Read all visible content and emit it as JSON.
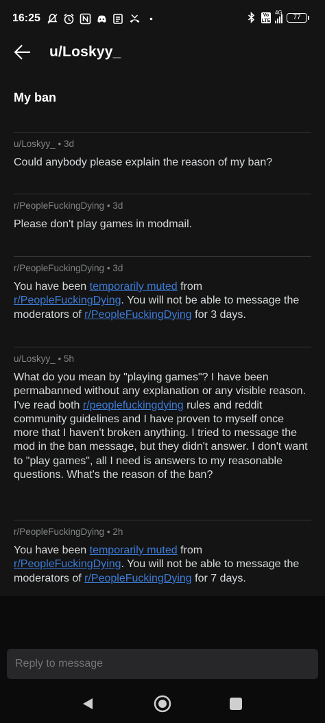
{
  "status_bar": {
    "time": "16:25",
    "network_label": "4G",
    "volte_label": "Vo LTE",
    "battery_level": "77",
    "icons": [
      "muted-notifications-icon",
      "alarm-icon",
      "nfc-icon",
      "discord-icon",
      "news-icon",
      "missed-call-icon",
      "dot-icon",
      "bluetooth-icon",
      "volte-icon",
      "signal-icon",
      "battery-icon"
    ]
  },
  "header": {
    "title": "u/Loskyy_",
    "subject": "My ban"
  },
  "messages": [
    {
      "author": "u/Loskyy_",
      "time": "3d",
      "body_parts": [
        "Could anybody please explain the reason of my ban?"
      ]
    },
    {
      "author": "r/PeopleFuckingDying",
      "time": "3d",
      "body_parts": [
        "Please don't play games in modmail."
      ]
    },
    {
      "author": "r/PeopleFuckingDying",
      "time": "3d",
      "body_parts": [
        "You have been ",
        "temporarily muted",
        " from ",
        "r/PeopleFuckingDying",
        ". You will not be able to message the moderators of ",
        "r/PeopleFuckingDying",
        " for 3 days."
      ]
    },
    {
      "author": "u/Loskyy_",
      "time": "5h",
      "body_parts": [
        "What do you mean by \"playing games\"? I have been permabanned without any explanation or any visible reason. I've read both ",
        "r/peoplefuckingdying",
        " rules and reddit community guidelines and I have proven to myself once more that I haven't broken anything. I tried to message the mod in the ban message, but they didn't answer. I don't want to \"play games\", all I need is answers to my reasonable questions. What's the reason of the ban?"
      ]
    },
    {
      "author": "r/PeopleFuckingDying",
      "time": "2h",
      "body_parts": [
        "You have been ",
        "temporarily muted",
        " from ",
        "r/PeopleFuckingDying",
        ". You will not be able to message the moderators of ",
        "r/PeopleFuckingDying",
        " for 7 days."
      ]
    }
  ],
  "reply": {
    "placeholder": "Reply to message"
  },
  "nav_bar": {
    "icons": [
      "nav-back-icon",
      "nav-home-icon",
      "nav-recents-icon"
    ]
  },
  "colors": {
    "background": "#141414",
    "text": "#d7dadc",
    "meta": "#818384",
    "link": "#3d7bd6",
    "divider": "#343536",
    "reply_bg": "#272729"
  }
}
